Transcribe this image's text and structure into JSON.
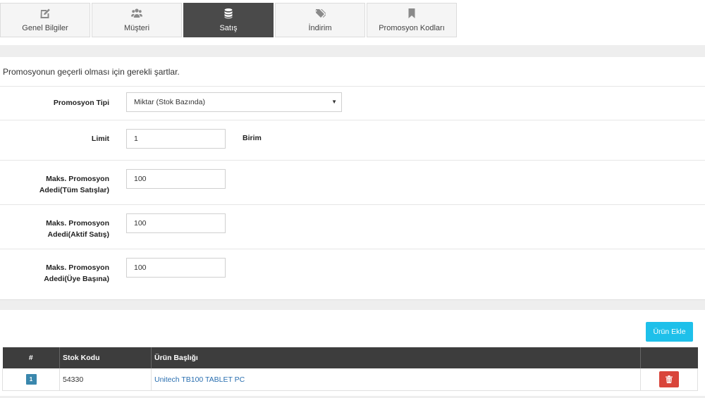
{
  "tabs": [
    {
      "label": "Genel Bilgiler",
      "icon": "edit-icon"
    },
    {
      "label": "Müşteri",
      "icon": "users-icon"
    },
    {
      "label": "Satış",
      "icon": "database-icon",
      "active": true
    },
    {
      "label": "İndirim",
      "icon": "tags-icon"
    },
    {
      "label": "Promosyon Kodları",
      "icon": "bookmark-icon"
    }
  ],
  "conditions": {
    "description": "Promosyonun geçerli olması için gerekli şartlar.",
    "promo_type": {
      "label": "Promosyon Tipi",
      "value": "Miktar (Stok Bazında)"
    },
    "limit": {
      "label": "Limit",
      "value": "1",
      "unit": "Birim"
    },
    "max_all": {
      "label_line1": "Maks. Promosyon",
      "label_line2": "Adedi(Tüm Satışlar)",
      "value": "100"
    },
    "max_active": {
      "label_line1": "Maks. Promosyon",
      "label_line2": "Adedi(Aktif Satış)",
      "value": "100"
    },
    "max_member": {
      "label_line1": "Maks. Promosyon",
      "label_line2": "Adedi(Üye Başına)",
      "value": "100"
    }
  },
  "products": {
    "add_button": "Ürün Ekle",
    "columns": {
      "num": "#",
      "code": "Stok Kodu",
      "title": "Ürün Başlığı",
      "action": ""
    },
    "rows": [
      {
        "num": "1",
        "code": "54330",
        "title": "Unitech TB100 TABLET PC"
      }
    ]
  },
  "colors": {
    "active_tab": "#4a4a4a",
    "add_button": "#1ec0ea",
    "delete_button": "#d9453b",
    "table_header": "#3d3d3d",
    "link": "#2a6fb0"
  }
}
